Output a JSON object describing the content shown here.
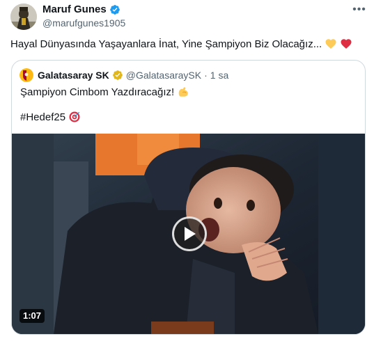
{
  "author": {
    "name": "Maruf Gunes",
    "handle": "@marufgunes1905",
    "verified": true
  },
  "tweet": {
    "text": "Hayal Dünyasında Yaşayanlara İnat, Yine Şampiyon Biz Olacağız...",
    "emojis": [
      "yellow-heart",
      "red-heart"
    ]
  },
  "menu": {
    "more_label": "•••"
  },
  "quoted_tweet": {
    "author_name": "Galatasaray SK",
    "author_handle": "@GalatasaraySK",
    "separator": "·",
    "time": "1 sa",
    "verified_badge": "gold",
    "line1": "Şampiyon Cimbom Yazdıracağız!",
    "line1_emoji": "flexed-biceps",
    "line2": "#Hedef25",
    "line2_emoji": "direct-hit",
    "video": {
      "duration": "1:07",
      "play_icon": "play-icon"
    }
  },
  "colors": {
    "text": "#0f1419",
    "secondary": "#536471",
    "verified_blue": "#1d9bf0",
    "verified_gold": "#e2b719",
    "border": "#cfd9de",
    "galatasaray_red": "#a90432",
    "galatasaray_yellow": "#fdb912"
  }
}
